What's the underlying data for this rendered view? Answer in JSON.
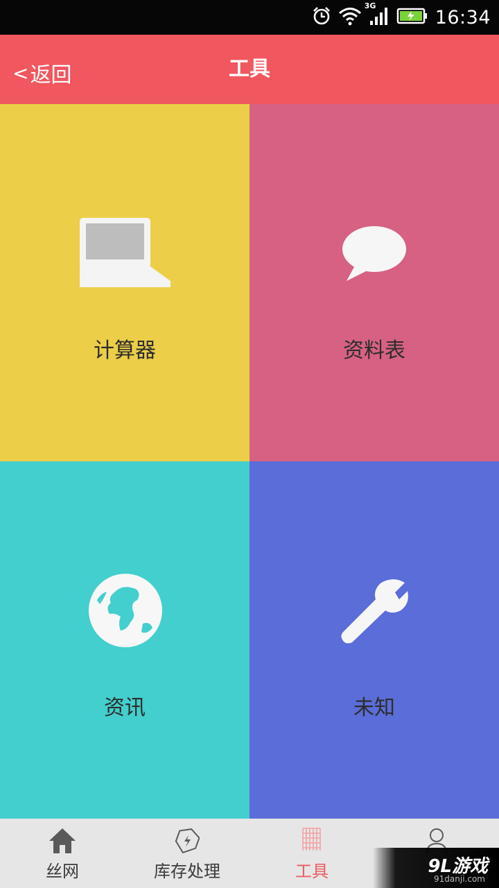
{
  "status_bar": {
    "time": "16:34",
    "network": "3G",
    "icons": [
      "alarm-icon",
      "wifi-icon",
      "signal-icon",
      "battery-icon"
    ]
  },
  "header": {
    "back_label": "返回",
    "back_chevron": "<",
    "title": "工具",
    "background": "#f0575f"
  },
  "tiles": [
    {
      "label": "计算器",
      "icon": "laptop-icon",
      "color": "#ecce48"
    },
    {
      "label": "资料表",
      "icon": "speech-bubble-icon",
      "color": "#d66183"
    },
    {
      "label": "资讯",
      "icon": "globe-icon",
      "color": "#43cfcd"
    },
    {
      "label": "未知",
      "icon": "wrench-icon",
      "color": "#5b6dd8"
    }
  ],
  "bottom_nav": {
    "active_index": 2,
    "active_color": "#ee5a62",
    "tabs": [
      {
        "label": "丝网",
        "icon": "home-icon"
      },
      {
        "label": "库存处理",
        "icon": "tag-icon"
      },
      {
        "label": "工具",
        "icon": "grid-icon"
      },
      {
        "label": "",
        "icon": "user-icon"
      }
    ]
  },
  "watermark": {
    "brand": "9L游戏",
    "site": "91danji.com"
  }
}
